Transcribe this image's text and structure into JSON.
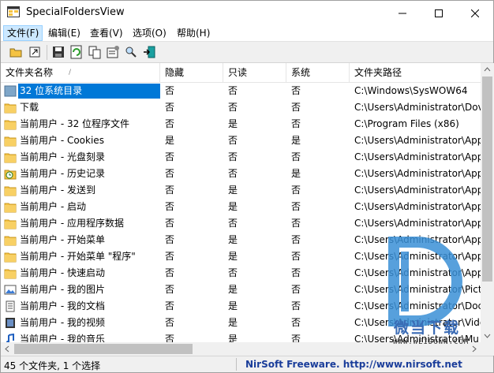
{
  "window": {
    "title": "SpecialFoldersView"
  },
  "menu": [
    "文件(F)",
    "编辑(E)",
    "查看(V)",
    "选项(O)",
    "帮助(H)"
  ],
  "toolbar_icons": [
    "open-folder-icon",
    "explore-icon",
    "save-icon",
    "refresh-icon",
    "copy-icon",
    "properties-icon",
    "find-icon",
    "exit-icon"
  ],
  "columns": [
    "文件夹名称",
    "隐藏",
    "只读",
    "系统",
    "文件夹路径"
  ],
  "rows": [
    {
      "name": "32 位系统目录",
      "hidden": "否",
      "readonly": "否",
      "system": "否",
      "path": "C:\\Windows\\SysWOW64",
      "icon": "system-folder",
      "selected": true
    },
    {
      "name": "下载",
      "hidden": "否",
      "readonly": "否",
      "system": "否",
      "path": "C:\\Users\\Administrator\\Dov",
      "icon": "folder"
    },
    {
      "name": "当前用户 - 32 位程序文件",
      "hidden": "否",
      "readonly": "是",
      "system": "否",
      "path": "C:\\Program Files (x86)",
      "icon": "folder"
    },
    {
      "name": "当前用户 - Cookies",
      "hidden": "是",
      "readonly": "否",
      "system": "是",
      "path": "C:\\Users\\Administrator\\App",
      "icon": "folder"
    },
    {
      "name": "当前用户 - 光盘刻录",
      "hidden": "否",
      "readonly": "否",
      "system": "否",
      "path": "C:\\Users\\Administrator\\App",
      "icon": "folder"
    },
    {
      "name": "当前用户 - 历史记录",
      "hidden": "否",
      "readonly": "否",
      "system": "是",
      "path": "C:\\Users\\Administrator\\App",
      "icon": "history-folder"
    },
    {
      "name": "当前用户 - 发送到",
      "hidden": "否",
      "readonly": "是",
      "system": "否",
      "path": "C:\\Users\\Administrator\\App",
      "icon": "folder"
    },
    {
      "name": "当前用户 - 启动",
      "hidden": "否",
      "readonly": "是",
      "system": "否",
      "path": "C:\\Users\\Administrator\\App",
      "icon": "folder"
    },
    {
      "name": "当前用户 - 应用程序数据",
      "hidden": "否",
      "readonly": "否",
      "system": "否",
      "path": "C:\\Users\\Administrator\\App",
      "icon": "folder"
    },
    {
      "name": "当前用户 - 开始菜单",
      "hidden": "否",
      "readonly": "是",
      "system": "否",
      "path": "C:\\Users\\Administrator\\App",
      "icon": "folder"
    },
    {
      "name": "当前用户 - 开始菜单 \"程序\"",
      "hidden": "否",
      "readonly": "是",
      "system": "否",
      "path": "C:\\Users\\Administrator\\App",
      "icon": "folder"
    },
    {
      "name": "当前用户 - 快速启动",
      "hidden": "否",
      "readonly": "否",
      "system": "否",
      "path": "C:\\Users\\Administrator\\App",
      "icon": "folder"
    },
    {
      "name": "当前用户 - 我的图片",
      "hidden": "否",
      "readonly": "是",
      "system": "否",
      "path": "C:\\Users\\Administrator\\Pict",
      "icon": "pictures-folder"
    },
    {
      "name": "当前用户 - 我的文档",
      "hidden": "否",
      "readonly": "是",
      "system": "否",
      "path": "C:\\Users\\Administrator\\Doc",
      "icon": "documents-folder"
    },
    {
      "name": "当前用户 - 我的视频",
      "hidden": "否",
      "readonly": "是",
      "system": "否",
      "path": "C:\\Users\\Administrator\\Vide",
      "icon": "videos-folder"
    },
    {
      "name": "当前用户 - 我的音乐",
      "hidden": "否",
      "readonly": "是",
      "system": "否",
      "path": "C:\\Users\\Administrator\\Mu",
      "icon": "music-folder"
    }
  ],
  "status": {
    "count": "45 个文件夹, 1 个选择",
    "credit": "NirSoft Freeware.  http://www.nirsoft.net"
  },
  "watermark": {
    "text": "微当下载",
    "url": "WWW.WEIDOWN.COM"
  },
  "colors": {
    "selection": "#0078d7",
    "folder": "#f5c342",
    "status_link": "#1a3d9a"
  }
}
